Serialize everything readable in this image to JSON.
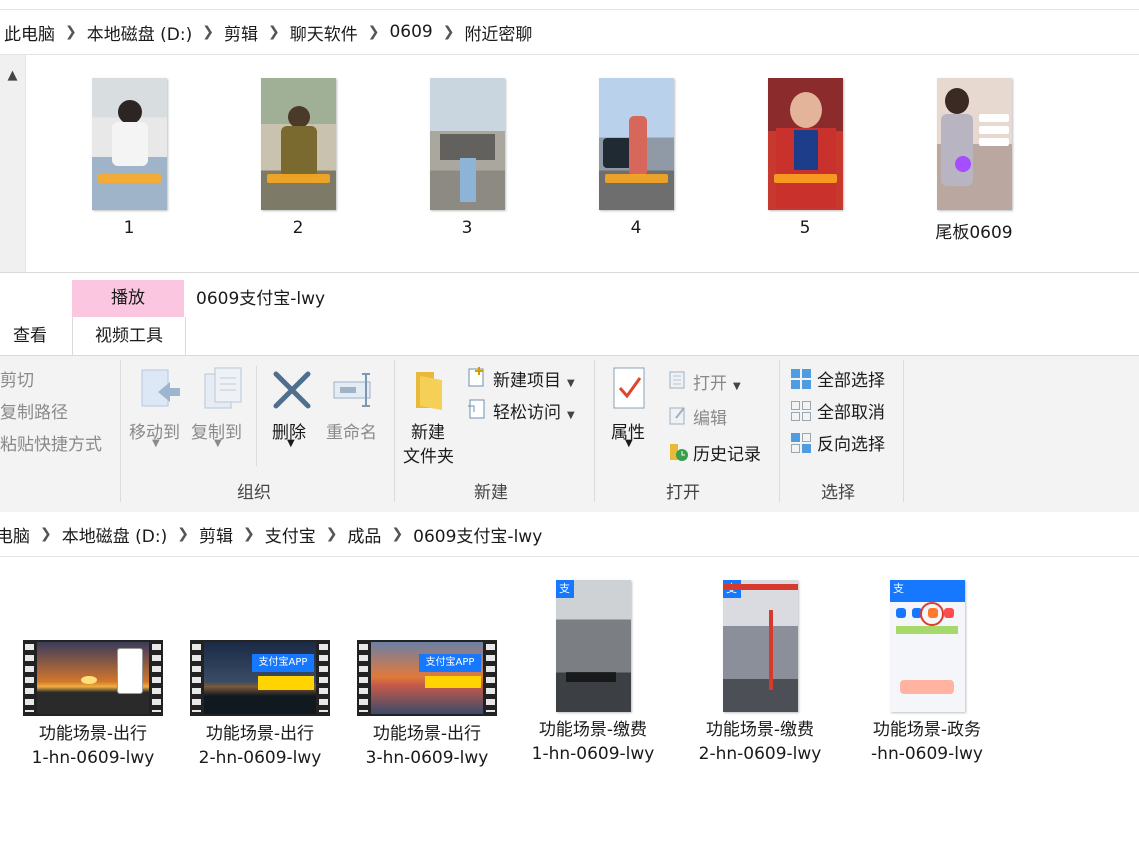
{
  "top_window": {
    "breadcrumb": [
      "此电脑",
      "本地磁盘 (D:)",
      "剪辑",
      "聊天软件",
      "0609",
      "附近密聊"
    ],
    "files": [
      {
        "name": "1",
        "thumb": "woman-white-top"
      },
      {
        "name": "2",
        "thumb": "woman-olive-dress"
      },
      {
        "name": "3",
        "thumb": "woman-street"
      },
      {
        "name": "4",
        "thumb": "woman-parking-lot"
      },
      {
        "name": "5",
        "thumb": "woman-red-jacket"
      },
      {
        "name": "尾板0609",
        "thumb": "woman-gray-top"
      }
    ]
  },
  "ribbon": {
    "tabs": {
      "view": "查看",
      "play": "播放",
      "video_tools": "视频工具"
    },
    "window_title": "0609支付宝-lwy",
    "clipboard": {
      "cut": "剪切",
      "copy_path": "复制路径",
      "paste_shortcut": "粘贴快捷方式"
    },
    "organize": {
      "move_to": "移动到",
      "copy_to": "复制到",
      "delete": "删除",
      "rename": "重命名",
      "group_label": "组织"
    },
    "new": {
      "new_folder_l1": "新建",
      "new_folder_l2": "文件夹",
      "new_item": "新建项目",
      "easy_access": "轻松访问",
      "group_label": "新建"
    },
    "open": {
      "properties": "属性",
      "open": "打开",
      "edit": "编辑",
      "history": "历史记录",
      "group_label": "打开"
    },
    "select": {
      "select_all": "全部选择",
      "select_none": "全部取消",
      "invert": "反向选择",
      "group_label": "选择"
    }
  },
  "bottom_window": {
    "breadcrumb_first": "电脑",
    "breadcrumb": [
      "本地磁盘 (D:)",
      "剪辑",
      "支付宝",
      "成品",
      "0609支付宝-lwy"
    ],
    "files": [
      {
        "l1": "功能场景-出行",
        "l2": "1-hn-0609-lwy",
        "thumb": "sunset-landscape"
      },
      {
        "l1": "功能场景-出行",
        "l2": "2-hn-0609-lwy",
        "thumb": "night-city",
        "overlay_title": "支付宝APP"
      },
      {
        "l1": "功能场景-出行",
        "l2": "3-hn-0609-lwy",
        "thumb": "sunset-sea",
        "overlay_title": "支付宝APP"
      },
      {
        "l1": "功能场景-缴费",
        "l2": "1-hn-0609-lwy",
        "thumb": "office-counter"
      },
      {
        "l1": "功能场景-缴费",
        "l2": "2-hn-0609-lwy",
        "thumb": "bank-hall"
      },
      {
        "l1": "功能场景-政务",
        "l2": "-hn-0609-lwy",
        "thumb": "app-screen"
      }
    ]
  },
  "colors": {
    "accent_tab": "#fbc6e0",
    "ribbon_bg": "#f3f3f3",
    "alipay_blue": "#1677ff"
  }
}
